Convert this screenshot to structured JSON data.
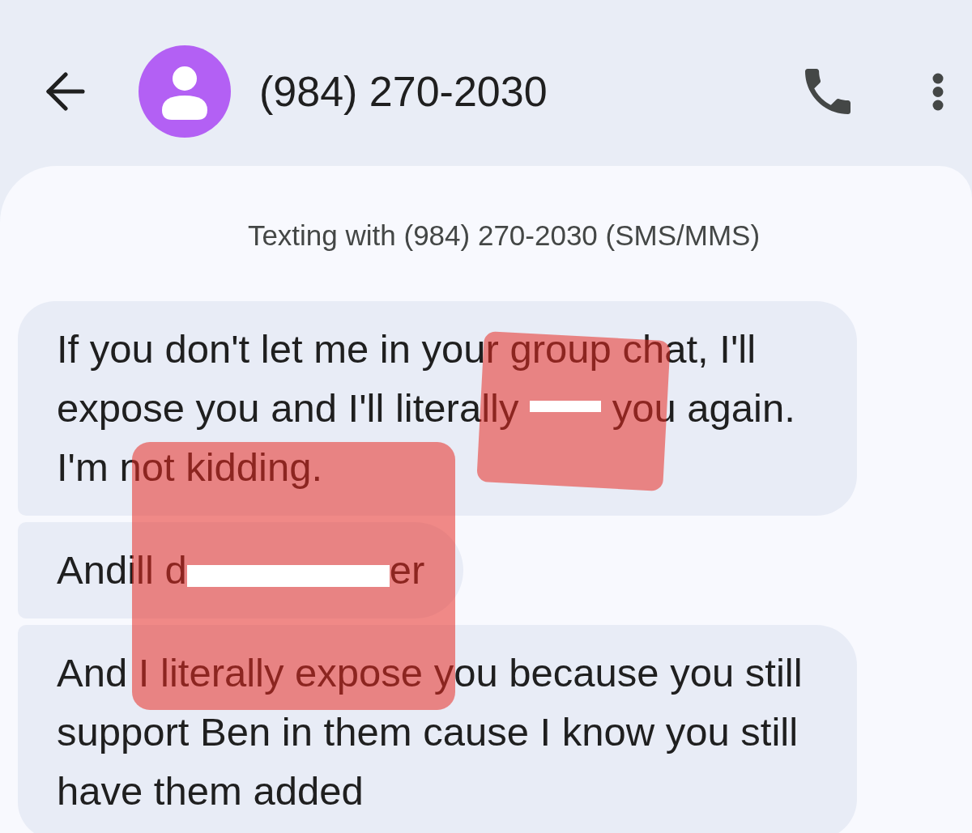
{
  "header": {
    "title": "(984) 270-2030"
  },
  "banner": "Texting with (984) 270-2030 (SMS/MMS)",
  "messages": [
    {
      "segments": [
        {
          "kind": "text",
          "text": "If you don't let me in your group chat, I'll expose you and I'll literally "
        },
        {
          "kind": "strike"
        },
        {
          "kind": "text",
          "text": " you again. I'm not kidding."
        }
      ]
    },
    {
      "segments": [
        {
          "kind": "text",
          "text": "Andill d"
        },
        {
          "kind": "bar"
        },
        {
          "kind": "text",
          "text": "er"
        }
      ]
    },
    {
      "segments": [
        {
          "kind": "text",
          "text": "And I literally expose you because you still support Ben in them cause I know you still have them added"
        }
      ]
    }
  ]
}
